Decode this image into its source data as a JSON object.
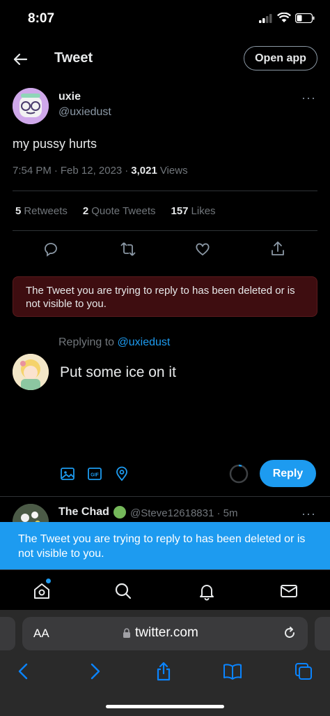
{
  "status": {
    "time": "8:07"
  },
  "header": {
    "title": "Tweet",
    "open_app": "Open app",
    "back_icon": "arrow-left-icon"
  },
  "tweet": {
    "author_name": "uxie",
    "author_handle": "@uxiedust",
    "text": "my pussy hurts",
    "time": "7:54 PM",
    "date": "Feb 12, 2023",
    "views_count": "3,021",
    "views_label": "Views",
    "retweets_count": "5",
    "retweets_label": "Retweets",
    "quotes_count": "2",
    "quotes_label": "Quote Tweets",
    "likes_count": "157",
    "likes_label": "Likes",
    "more": "···"
  },
  "error_box": {
    "text": "The Tweet you are trying to reply to has been deleted or is not visible to you."
  },
  "compose": {
    "replying_prefix": "Replying to",
    "replying_to": "@uxiedust",
    "text": "Put some ice on it",
    "reply_button": "Reply"
  },
  "next_tweet": {
    "name": "The Chad",
    "handle_time": "@Steve12618831 · 5m",
    "more": "···"
  },
  "toast": {
    "text": "The Tweet you are trying to reply to has been deleted or is not visible to you."
  },
  "safari": {
    "aa_label": "AA",
    "url": "twitter.com"
  },
  "colors": {
    "accent": "#1d9bf0",
    "error_bg": "#3e0d10",
    "muted": "#71767b"
  }
}
